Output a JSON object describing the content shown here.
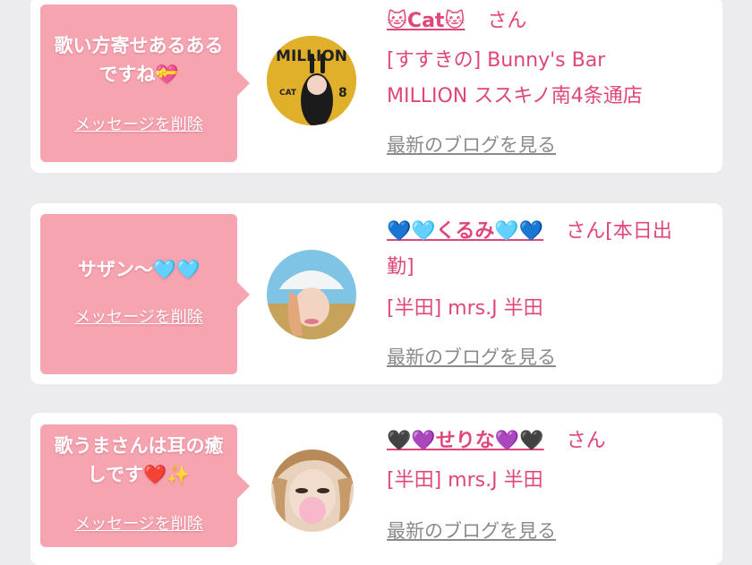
{
  "cards": [
    {
      "message": "歌い方寄せあるあるですね💝",
      "delete_label": "メッセージを削除",
      "name": "🐱Cat🐱",
      "honorific": "さん",
      "shop_line1": "[すすきの] Bunny's Bar",
      "shop_line2": "MILLION ススキノ南4条通店",
      "blog_label": "最新のブログを見る",
      "avatar_text": "MILLION",
      "avatar_sub": "CAT",
      "avatar_num": "8"
    },
    {
      "message": "サザン〜🩵🩵",
      "delete_label": "メッセージを削除",
      "name": "💙🩵くるみ🩵💙",
      "honorific": "さん[本日出",
      "honorific2": "勤]",
      "shop_line1": "[半田] mrs.J 半田",
      "blog_label": "最新のブログを見る"
    },
    {
      "message": "歌うまさんは耳の癒しです❤️✨",
      "delete_label": "メッセージを削除",
      "name": "🖤💜せりな💜🖤",
      "honorific": "さん",
      "shop_line1": "[半田] mrs.J 半田",
      "blog_label": "最新のブログを見る"
    }
  ],
  "colors": {
    "accent": "#e0457b",
    "bubble": "#f7a4b1",
    "link_gray": "#8a8a8a",
    "background": "#ececee"
  }
}
